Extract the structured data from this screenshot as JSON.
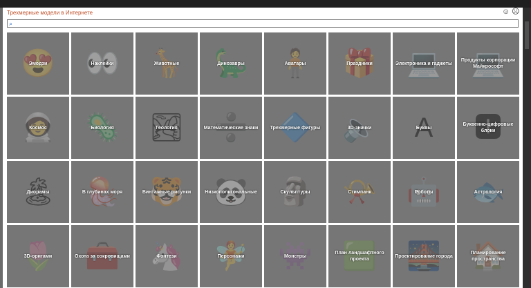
{
  "dialog": {
    "title": "Трехмерные модели в Интернете",
    "feedback_icons": [
      "smiley-happy-icon",
      "smiley-sad-icon"
    ],
    "search": {
      "placeholder": "",
      "value": ""
    }
  },
  "categories": [
    {
      "label": "Эмодзи",
      "icon": "emoji-icon",
      "glyph": "😍",
      "color": "#8a8a8a"
    },
    {
      "label": "Наклейки",
      "icon": "sticker-icon",
      "glyph": "👀",
      "color": "#8c8c8c"
    },
    {
      "label": "Животные",
      "icon": "giraffe-icon",
      "glyph": "🦒",
      "color": "#888888"
    },
    {
      "label": "Динозавры",
      "icon": "dinosaur-icon",
      "glyph": "🦕",
      "color": "#8a8a8a"
    },
    {
      "label": "Аватары",
      "icon": "avatar-icon",
      "glyph": "🧍",
      "color": "#8b8b8b"
    },
    {
      "label": "Праздники",
      "icon": "gift-icon",
      "glyph": "🎁",
      "color": "#8a8a8a"
    },
    {
      "label": "Электроника и гаджеты",
      "icon": "laptop-icon",
      "glyph": "💻",
      "color": "#8b8b8b"
    },
    {
      "label": "Продукты корпорации Майкрософт",
      "icon": "surface-laptop-icon",
      "glyph": "💻",
      "color": "#888888"
    },
    {
      "label": "Космос",
      "icon": "astronaut-icon",
      "glyph": "🧑‍🚀",
      "color": "#8c8c8c"
    },
    {
      "label": "Биология",
      "icon": "cell-icon",
      "glyph": "🦠",
      "color": "#8a8a8a"
    },
    {
      "label": "Геология",
      "icon": "terrain-icon",
      "glyph": "🏞",
      "color": "#8b8b8b"
    },
    {
      "label": "Математические знаки",
      "icon": "division-sign-icon",
      "glyph": "➗",
      "color": "#8a8a8a"
    },
    {
      "label": "Трехмерные фигуры",
      "icon": "cone-icon",
      "glyph": "🔷",
      "color": "#8b8b8b"
    },
    {
      "label": "3D-значки",
      "icon": "speaker-icon",
      "glyph": "🔈",
      "color": "#8a8a8a"
    },
    {
      "label": "Буквы",
      "icon": "letter-a-icon",
      "glyph": "A",
      "color": "#8c8c8c"
    },
    {
      "label": "Буквенно-цифровые блоки",
      "icon": "letter-block-icon",
      "glyph": "🅸",
      "color": "#8a8a8a"
    },
    {
      "label": "Диорамы",
      "icon": "diorama-icon",
      "glyph": "🏝",
      "color": "#8a8a8a"
    },
    {
      "label": "В глубинах моря",
      "icon": "jellyfish-icon",
      "glyph": "🪼",
      "color": "#8b8b8b"
    },
    {
      "label": "Винтажные рисунки",
      "icon": "vintage-tiger-icon",
      "glyph": "🐯",
      "color": "#8a8a8a"
    },
    {
      "label": "Низкополигональные",
      "icon": "panda-icon",
      "glyph": "🐼",
      "color": "#8b8b8b"
    },
    {
      "label": "Скульптуры",
      "icon": "bust-icon",
      "glyph": "🗿",
      "color": "#8c8c8c"
    },
    {
      "label": "Стимпанк",
      "icon": "gramophone-icon",
      "glyph": "📯",
      "color": "#8a8a8a"
    },
    {
      "label": "Роботы",
      "icon": "robot-icon",
      "glyph": "🤖",
      "color": "#8b8b8b"
    },
    {
      "label": "Астрология",
      "icon": "fish-icon",
      "glyph": "🐟",
      "color": "#8a8a8a"
    },
    {
      "label": "3D-оригами",
      "icon": "origami-icon",
      "glyph": "🌷",
      "color": "#8b8b8b"
    },
    {
      "label": "Охота за сокровищами",
      "icon": "treasure-chest-icon",
      "glyph": "🧰",
      "color": "#8a8a8a"
    },
    {
      "label": "Фэнтези",
      "icon": "pegasus-icon",
      "glyph": "🦄",
      "color": "#8c8c8c"
    },
    {
      "label": "Персонажи",
      "icon": "character-icon",
      "glyph": "🧚",
      "color": "#8a8a8a"
    },
    {
      "label": "Монстры",
      "icon": "monster-icon",
      "glyph": "👾",
      "color": "#8b8b8b"
    },
    {
      "label": "План ландшафтного проекта",
      "icon": "landscape-icon",
      "glyph": "🟩",
      "color": "#8a8a8a"
    },
    {
      "label": "Проектирование города",
      "icon": "bridge-icon",
      "glyph": "🌉",
      "color": "#8b8b8b"
    },
    {
      "label": "Планирование пространства",
      "icon": "room-icon",
      "glyph": "🏠",
      "color": "#8a8a8a"
    }
  ]
}
